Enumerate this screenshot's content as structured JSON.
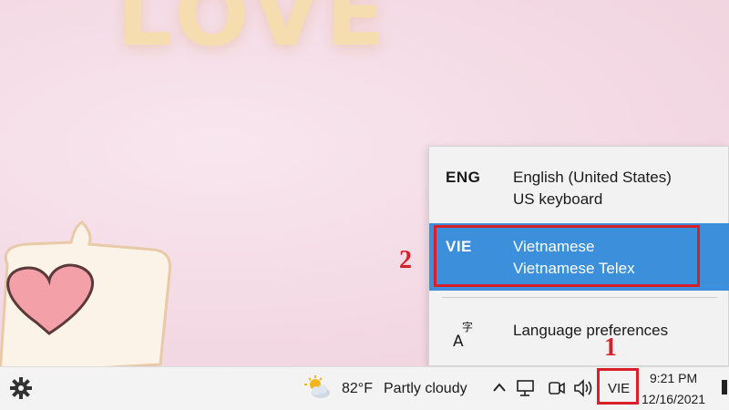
{
  "wallpaper": {
    "word": "LOVE"
  },
  "language_flyout": {
    "options": [
      {
        "code": "ENG",
        "name": "English (United States)",
        "layout": "US keyboard"
      },
      {
        "code": "VIE",
        "name": "Vietnamese",
        "layout": "Vietnamese Telex"
      }
    ],
    "preferences_label": "Language preferences"
  },
  "annotations": {
    "step1": "1",
    "step2": "2"
  },
  "taskbar": {
    "weather": {
      "icon": "partly-cloudy-icon",
      "temperature": "82°F",
      "condition": "Partly cloudy"
    },
    "input_indicator": "VIE",
    "time": "9:21 PM",
    "date": "12/16/2021"
  },
  "colors": {
    "selection": "#3b8fdb",
    "annotation_red": "#d8202a"
  }
}
